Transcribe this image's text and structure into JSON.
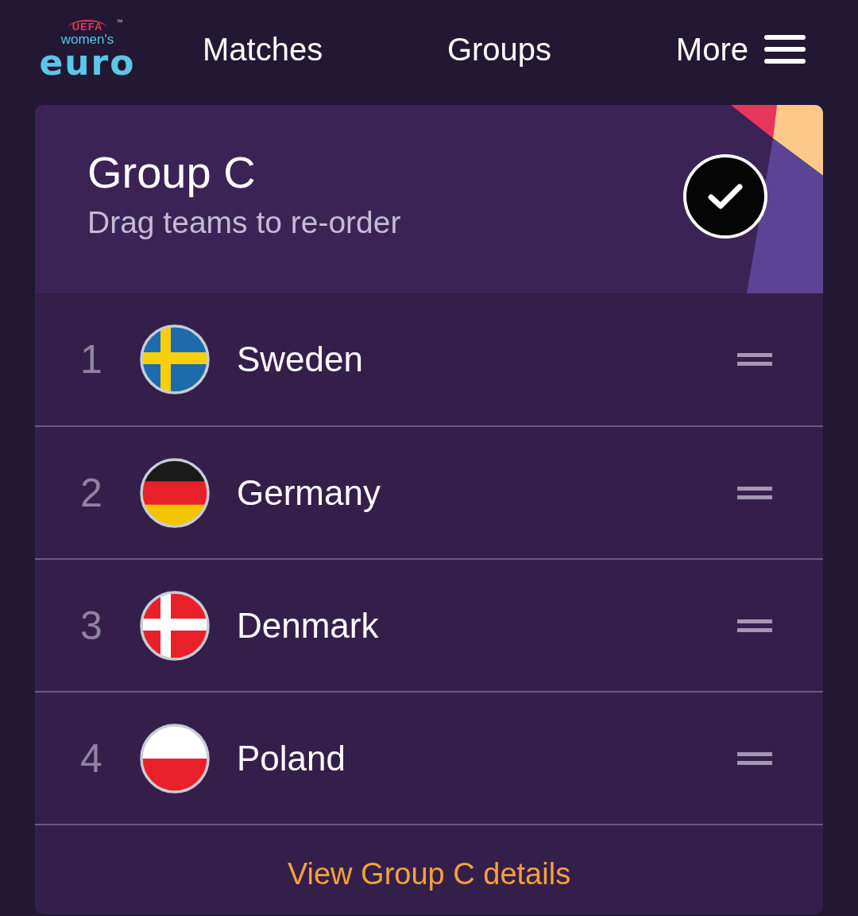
{
  "logo": {
    "badge": "UEFA",
    "trademark": "™",
    "tagline": "women's",
    "wordmark": "euro"
  },
  "nav": {
    "items": [
      {
        "label": "Matches",
        "kind": "link"
      },
      {
        "label": "Groups",
        "kind": "link"
      },
      {
        "label": "More",
        "kind": "menu"
      }
    ]
  },
  "group": {
    "title": "Group C",
    "subtitle": "Drag teams to re-order",
    "confirmed": true
  },
  "teams": [
    {
      "rank": "1",
      "name": "Sweden",
      "flag": {
        "kind": "cross",
        "parts": [
          {
            "color": "#1d6bad"
          },
          {
            "color": "#f6cf0d"
          }
        ]
      }
    },
    {
      "rank": "2",
      "name": "Germany",
      "flag": {
        "kind": "stripes",
        "parts": [
          {
            "color": "#1a1a1a"
          },
          {
            "color": "#e8202a"
          },
          {
            "color": "#f5c400"
          }
        ]
      }
    },
    {
      "rank": "3",
      "name": "Denmark",
      "flag": {
        "kind": "cross",
        "parts": [
          {
            "color": "#e8202a"
          },
          {
            "color": "#ffffff"
          }
        ]
      }
    },
    {
      "rank": "4",
      "name": "Poland",
      "flag": {
        "kind": "stripes",
        "parts": [
          {
            "color": "#ffffff"
          },
          {
            "color": "#e8202a"
          }
        ]
      }
    }
  ],
  "details_link": "View Group C details"
}
